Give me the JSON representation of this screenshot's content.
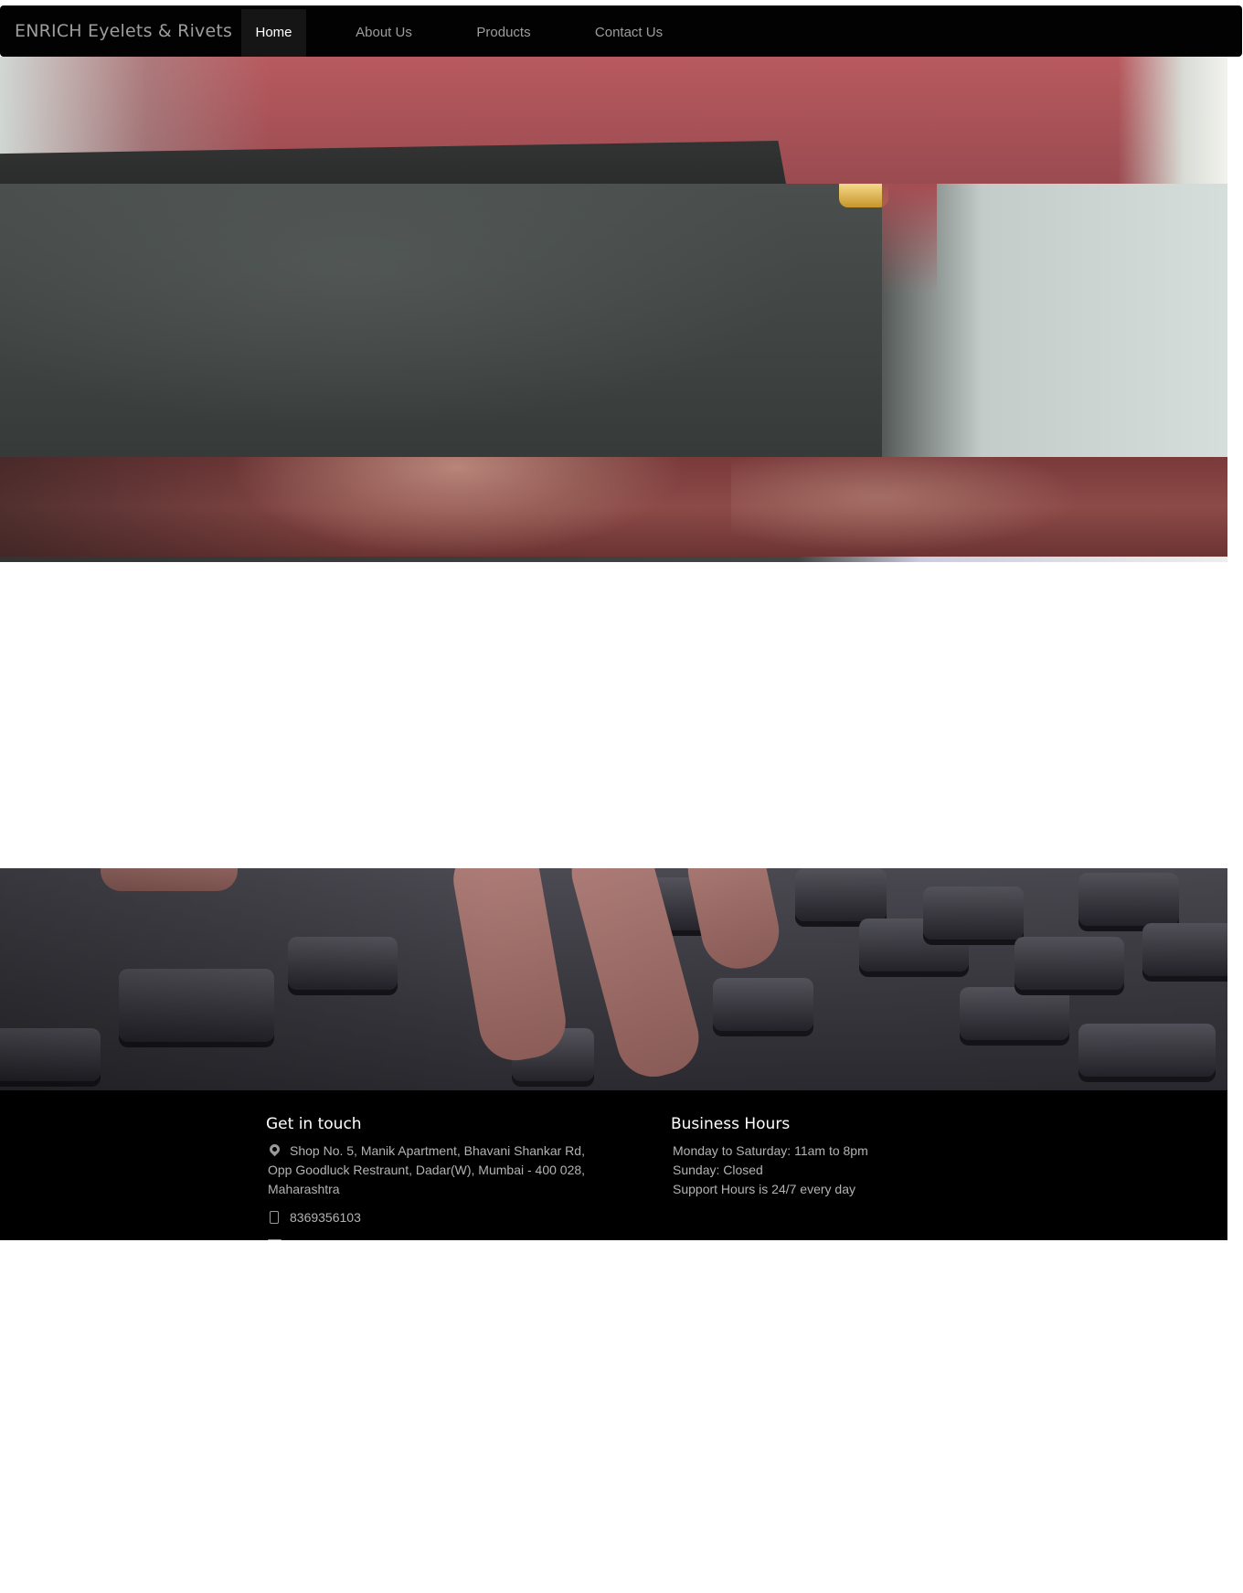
{
  "navbar": {
    "brand": "ENRICH Eyelets & Rivets",
    "items": [
      {
        "label": "Home",
        "active": true
      },
      {
        "label": "About Us",
        "active": false
      },
      {
        "label": "Products",
        "active": false
      },
      {
        "label": "Contact Us",
        "active": false
      }
    ]
  },
  "carousel": {
    "slide_count": 5,
    "active_index": 2
  },
  "footer": {
    "contact": {
      "title": "Get in touch",
      "address_lines": [
        "Shop No. 5, Manik Apartment, Bhavani Shankar Rd,",
        "Opp Goodluck Restraunt, Dadar(W), Mumbai - 400 028,",
        "Maharashtra"
      ],
      "phone": "8369356103",
      "icons": [
        "map-marker-icon",
        "mobile-phone-icon",
        "envelope-icon"
      ]
    },
    "hours": {
      "title": "Business Hours",
      "lines": [
        "Monday to Saturday: 11am to 8pm",
        "Sunday: Closed",
        "Support Hours is 24/7 every day"
      ]
    }
  },
  "colors": {
    "navbar_bg": "#020202",
    "nav_text": "#9d9d9d",
    "nav_active_text": "#ffffff",
    "footer_bg": "#000000",
    "footer_text": "#b3b3b3"
  }
}
